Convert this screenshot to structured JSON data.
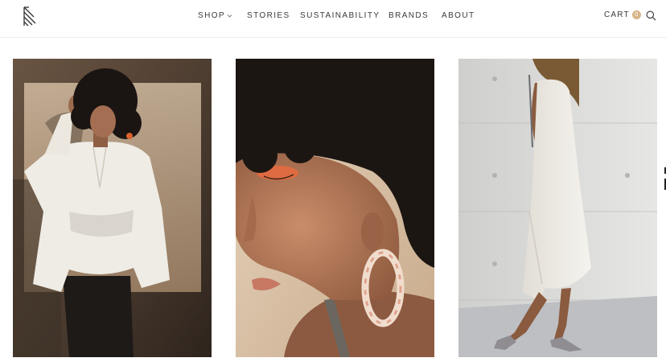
{
  "header": {
    "logo_icon": "brand-monogram-icon",
    "nav": [
      {
        "label": "SHOP",
        "has_dropdown": true
      },
      {
        "label": "STORIES"
      },
      {
        "label": "SUSTAINABILITY"
      },
      {
        "label": "BRANDS"
      },
      {
        "label": "ABOUT"
      }
    ],
    "cart_label": "CART",
    "cart_count": "0",
    "search_icon": "search-icon"
  },
  "gallery": [
    {
      "subject": "woman-white-shirt-photo"
    },
    {
      "subject": "earring-closeup-photo"
    },
    {
      "subject": "white-slip-dress-photo"
    }
  ],
  "colors": {
    "accent": "#d8b58a",
    "text": "#3a3a3a"
  }
}
